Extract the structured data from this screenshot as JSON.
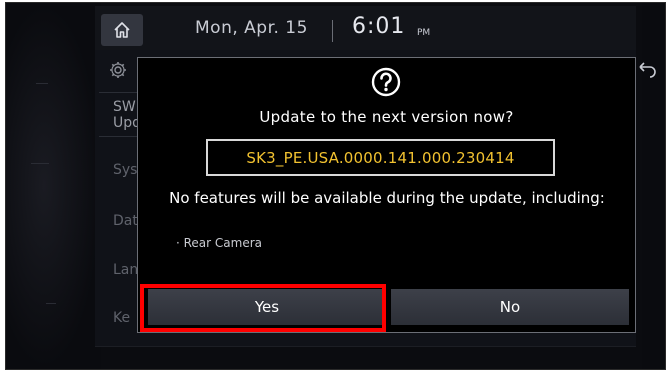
{
  "status_bar": {
    "home_icon": "home-icon",
    "date": "Mon, Apr. 15",
    "time": "6:01",
    "ampm": "PM"
  },
  "sidebar": {
    "gear_icon": "gear-icon",
    "items": [
      {
        "label": "SW\nUpd"
      },
      {
        "label": "Sys"
      },
      {
        "label": "Dat"
      },
      {
        "label": "Lan"
      },
      {
        "label": "Ke"
      }
    ]
  },
  "dialog": {
    "icon": "question-icon",
    "title": "Update to the next version now?",
    "version": "SK3_PE.USA.0000.141.000.230414",
    "warning": "No features will be available during the update, including:",
    "features": [
      "· Rear Camera"
    ],
    "yes_label": "Yes",
    "no_label": "No"
  },
  "colors": {
    "version_text": "#f2c230",
    "highlight": "#ff0000",
    "dialog_bg": "#000000",
    "button_bg": "#363942"
  }
}
